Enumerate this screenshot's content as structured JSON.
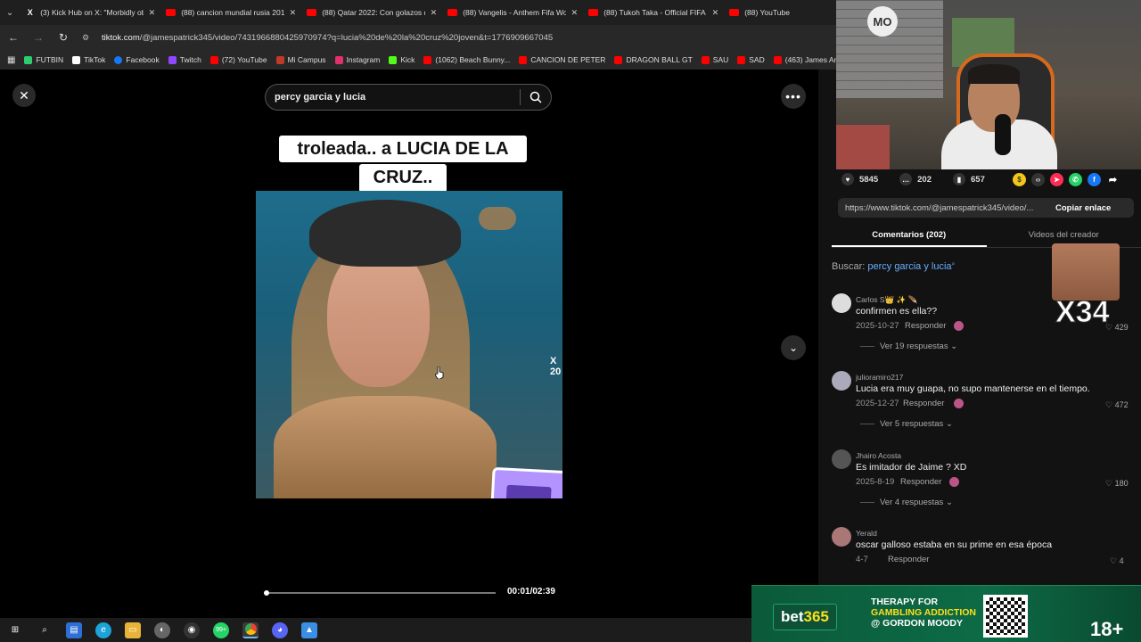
{
  "browser": {
    "tabs": [
      {
        "title": "(3) Kick Hub on X: \"Morbidly ob",
        "icon": "x-icon"
      },
      {
        "title": "(88) cancion mundial rusia 2018",
        "icon": "youtube-icon"
      },
      {
        "title": "(88) Qatar 2022: Con golazos de",
        "icon": "youtube-icon"
      },
      {
        "title": "(88) Vangelis - Anthem Fifa Wo",
        "icon": "youtube-icon"
      },
      {
        "title": "(88) Tukoh Taka - Official FIFA F",
        "icon": "youtube-icon"
      },
      {
        "title": "(88) YouTube",
        "icon": "youtube-icon"
      }
    ],
    "url_host": "tiktok.com",
    "url_path": "/@jamespatrick345/video/7431966880425970974?q=lucia%20de%20la%20cruz%20joven&t=1776909667045",
    "bookmarks": [
      {
        "label": "FUTBIN",
        "color": "#2ecc71"
      },
      {
        "label": "TikTok",
        "color": "#ffffff"
      },
      {
        "label": "Facebook",
        "color": "#1877f2"
      },
      {
        "label": "Twitch",
        "color": "#9146ff"
      },
      {
        "label": "(72) YouTube",
        "color": "#ff0000"
      },
      {
        "label": "Mi Campus",
        "color": "#c0392b"
      },
      {
        "label": "Instagram",
        "color": "#e1306c"
      },
      {
        "label": "Kick",
        "color": "#53fc18"
      },
      {
        "label": "(1062) Beach Bunny...",
        "color": "#ff0000"
      },
      {
        "label": "CANCION DE PETER",
        "color": "#ff0000"
      },
      {
        "label": "DRAGON BALL GT",
        "color": "#ff0000"
      },
      {
        "label": "SAU",
        "color": "#ff0000"
      },
      {
        "label": "SAD",
        "color": "#ff0000"
      },
      {
        "label": "(463) James Arthur",
        "color": "#ff0000"
      }
    ]
  },
  "tiktok": {
    "search_query": "percy garcia y lucia",
    "caption_line1": "troleada.. a LUCIA DE LA",
    "caption_line2": "CRUZ..",
    "video_edge_text": "X 20",
    "progress_fraction": 0.006,
    "time": "00:01/02:39",
    "stats": {
      "likes": "5845",
      "comments": "202",
      "saves": "657"
    },
    "share_link": "https://www.tiktok.com/@jamespatrick345/video/...",
    "copy_label": "Copiar enlace",
    "tab_comments": "Comentarios (202)",
    "tab_creator": "Videos del creador",
    "search_prefix": "Buscar:",
    "search_query_link": "percy garcia y lucia",
    "comments": [
      {
        "user": "Carlos S👑 ✨ 🪶",
        "text": "confirmen es ella??",
        "date": "2025-10-27",
        "reply": "Responder",
        "likes": "429",
        "more": "Ver 19 respuestas"
      },
      {
        "user": "julioramiro217",
        "text": "Lucia era muy guapa, no supo mantenerse en el tiempo.",
        "date": "2025-12-27",
        "reply": "Responder",
        "likes": "472",
        "more": "Ver 5 respuestas"
      },
      {
        "user": "Jhairo Acosta",
        "text": "Es imitador de Jaime ? XD",
        "date": "2025-8-19",
        "reply": "Responder",
        "likes": "180",
        "more": "Ver 4 respuestas"
      },
      {
        "user": "Yerald",
        "text": "oscar galloso estaba en su prime en esa época",
        "date": "4-7",
        "reply": "Responder",
        "likes": "4",
        "more": ""
      }
    ]
  },
  "overlay": {
    "webcam_logo": "MO",
    "meme_text": "X34",
    "ad_brand_a": "bet",
    "ad_brand_b": "365",
    "ad_line1": "THERAPY FOR",
    "ad_line2": "GAMBLING ADDICTION",
    "ad_line3": "@ GORDON MOODY",
    "ad_age": "18+"
  },
  "taskbar": {
    "badge": "99+"
  }
}
